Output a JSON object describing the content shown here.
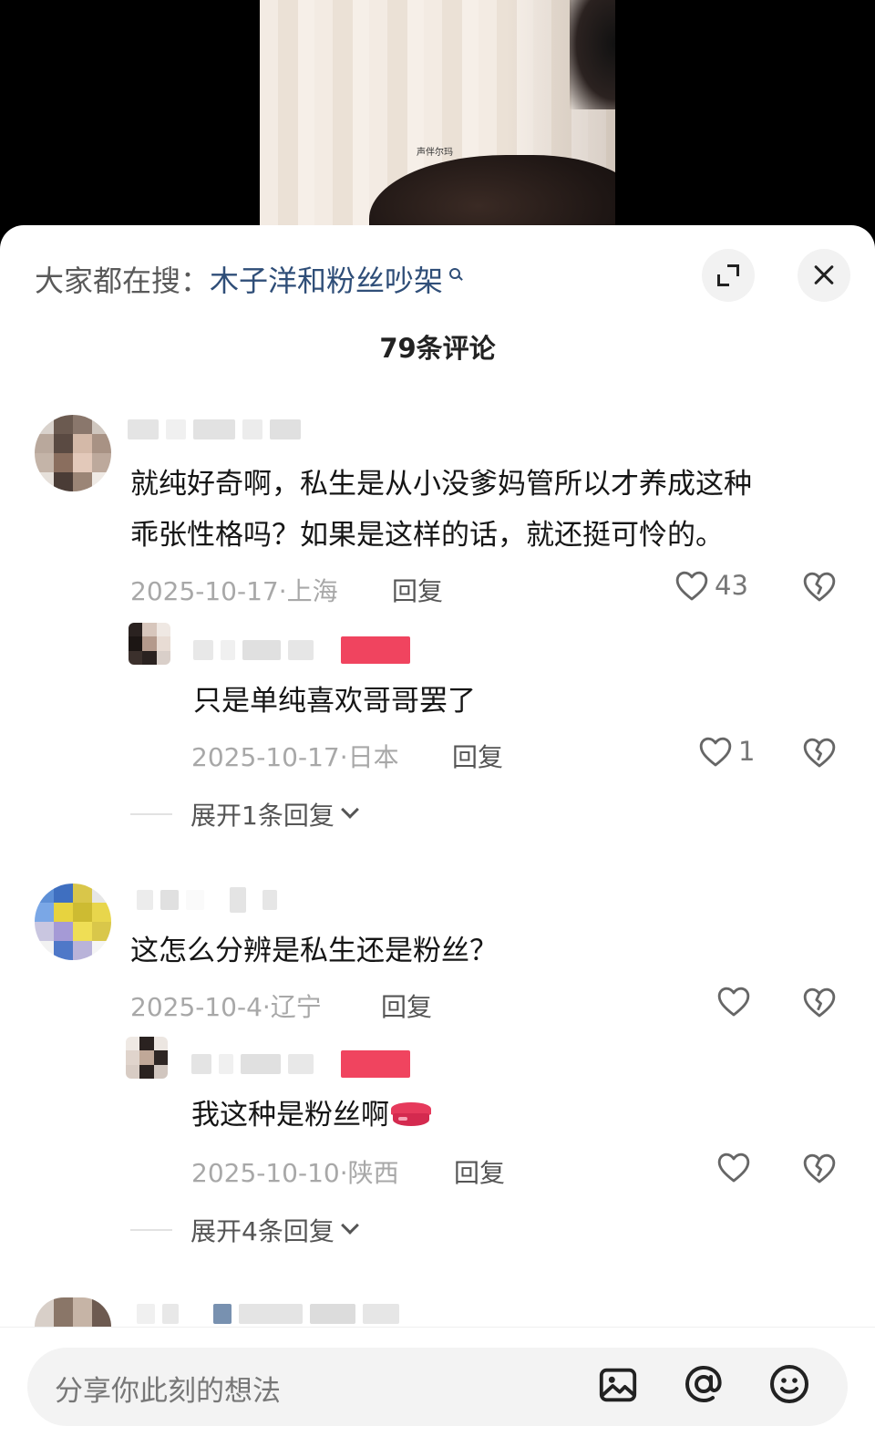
{
  "video": {
    "watermark": "声伴尔玛"
  },
  "sheet": {
    "search_prefix": "大家都在搜：",
    "search_keyword": "木子洋和粉丝吵架",
    "comment_count": "79条评论"
  },
  "comments": [
    {
      "text_lines": [
        "就纯好奇啊，私生是从小没爹妈管所以才养成这种",
        "乖张性格吗？如果是这样的话，就还挺可怜的。"
      ],
      "meta": "2025-10-17·上海",
      "reply_label": "回复",
      "likes": "43",
      "replies": [
        {
          "text": "只是单纯喜欢哥哥罢了",
          "meta": "2025-10-17·日本",
          "reply_label": "回复",
          "likes": "1"
        }
      ],
      "expand_label": "展开1条回复"
    },
    {
      "text_lines": [
        "这怎么分辨是私生还是粉丝？"
      ],
      "meta": "2025-10-4·辽宁",
      "reply_label": "回复",
      "likes": "",
      "replies": [
        {
          "text": "我这种是粉丝啊",
          "emoji": "kiss-lips",
          "meta": "2025-10-10·陕西",
          "reply_label": "回复",
          "likes": ""
        }
      ],
      "expand_label": "展开4条回复"
    }
  ],
  "input": {
    "placeholder": "分享你此刻的想法"
  },
  "icons": {
    "image": "image-icon",
    "mention": "at-icon",
    "emoji": "emoji-icon",
    "like": "heart-icon",
    "dislike": "broken-heart-icon",
    "expand": "expand-icon",
    "close": "close-icon"
  },
  "colors": {
    "keyword": "#2f4e78",
    "author_tag": "#f0445f",
    "meta": "#a8a8a8"
  }
}
